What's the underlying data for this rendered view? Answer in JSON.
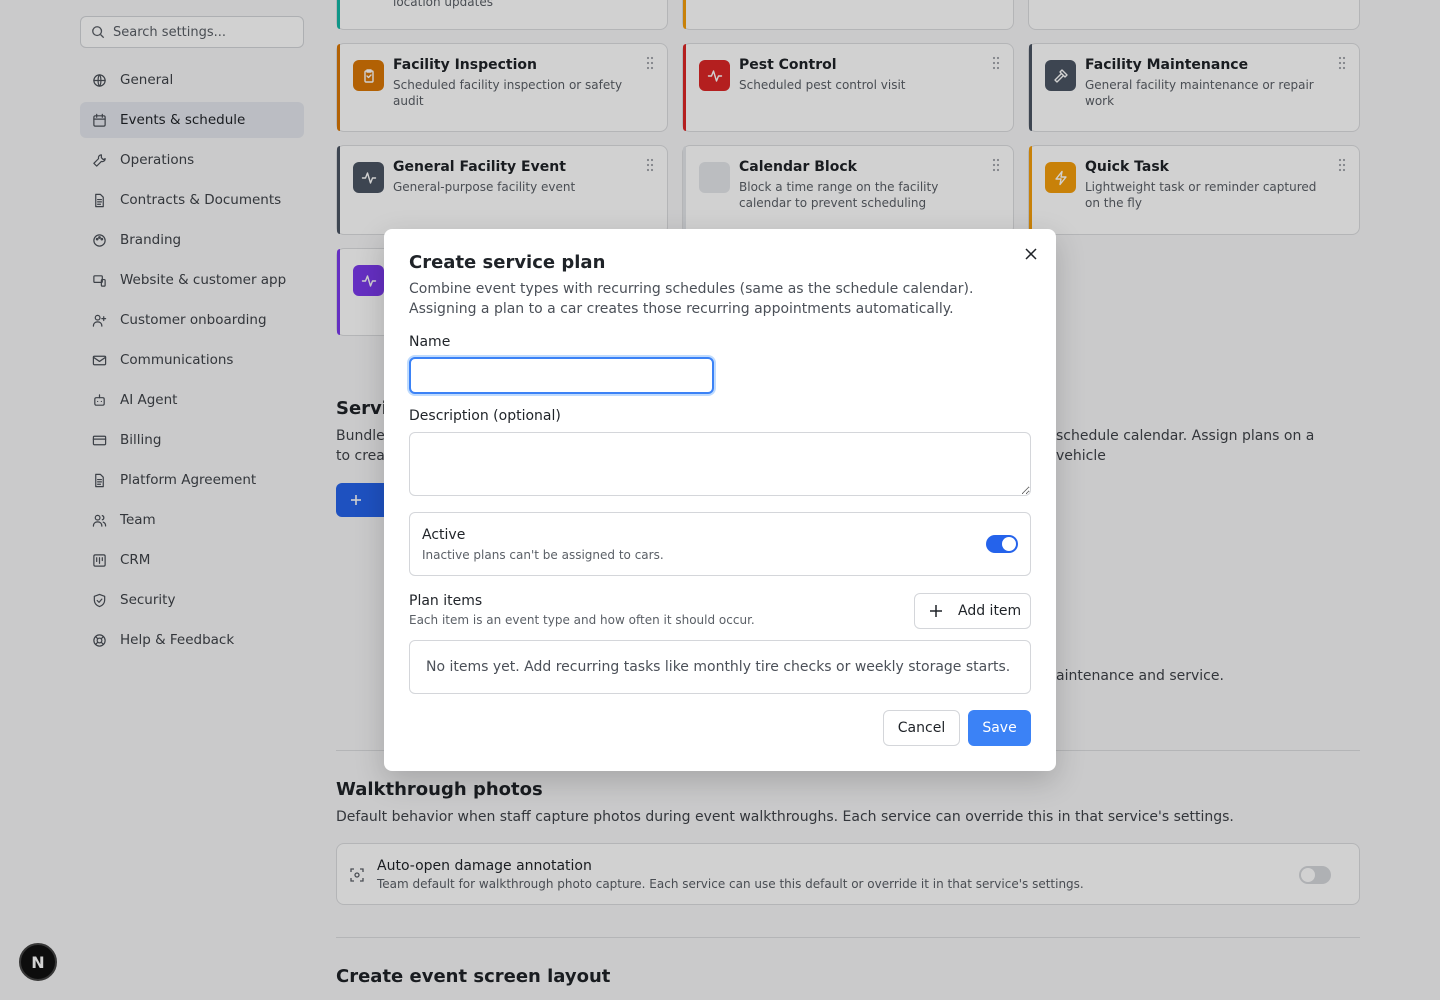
{
  "sidebar": {
    "search_placeholder": "Search settings...",
    "items": [
      {
        "label": "General",
        "icon": "globe-icon",
        "active": false
      },
      {
        "label": "Events & schedule",
        "icon": "calendar-icon",
        "active": true
      },
      {
        "label": "Operations",
        "icon": "wrench-icon",
        "active": false
      },
      {
        "label": "Contracts & Documents",
        "icon": "document-icon",
        "active": false
      },
      {
        "label": "Branding",
        "icon": "palette-icon",
        "active": false
      },
      {
        "label": "Website & customer app",
        "icon": "devices-icon",
        "active": false
      },
      {
        "label": "Customer onboarding",
        "icon": "user-plus-icon",
        "active": false
      },
      {
        "label": "Communications",
        "icon": "mail-icon",
        "active": false
      },
      {
        "label": "AI Agent",
        "icon": "bot-icon",
        "active": false
      },
      {
        "label": "Billing",
        "icon": "credit-card-icon",
        "active": false
      },
      {
        "label": "Platform Agreement",
        "icon": "document-icon",
        "active": false
      },
      {
        "label": "Team",
        "icon": "users-icon",
        "active": false
      },
      {
        "label": "CRM",
        "icon": "crm-icon",
        "active": false
      },
      {
        "label": "Security",
        "icon": "shield-icon",
        "active": false
      },
      {
        "label": "Help & Feedback",
        "icon": "lifebuoy-icon",
        "active": false
      }
    ]
  },
  "event_cards": {
    "top_partial_text": "location updates",
    "cards": [
      {
        "title": "Facility Inspection",
        "desc": "Scheduled facility inspection or safety audit",
        "color": "#d97706",
        "icon": "clipboard-icon"
      },
      {
        "title": "Pest Control",
        "desc": "Scheduled pest control visit",
        "color": "#dc2626",
        "icon": "activity-icon"
      },
      {
        "title": "Facility Maintenance",
        "desc": "General facility maintenance or repair work",
        "color": "#4b5563",
        "icon": "hammer-icon"
      },
      {
        "title": "General Facility Event",
        "desc": "General-purpose facility event",
        "color": "#4b5563",
        "icon": "activity-icon"
      },
      {
        "title": "Calendar Block",
        "desc": "Block a time range on the facility calendar to prevent scheduling",
        "color": "#e5e7eb",
        "icon": "block-icon"
      },
      {
        "title": "Quick Task",
        "desc": "Lightweight task or reminder captured on the fly",
        "color": "#f59e0b",
        "icon": "zap-icon"
      },
      {
        "title": "",
        "desc": "",
        "color": "#7c3aed",
        "icon": "activity-icon"
      }
    ]
  },
  "service_plans": {
    "title_partial": "Servi",
    "desc_line1_partial": "Bundle",
    "desc_line2_partial": "to creat",
    "desc_right": "schedule calendar. Assign plans on a vehicle",
    "maint_right": "aintenance and service."
  },
  "walkthrough": {
    "title": "Walkthrough photos",
    "desc": "Default behavior when staff capture photos during event walkthroughs. Each service can override this in that service's settings.",
    "setting_title": "Auto-open damage annotation",
    "setting_desc": "Team default for walkthrough photo capture. Each service can use this default or override it in that service's settings.",
    "enabled": false
  },
  "layout_section": {
    "title": "Create event screen layout"
  },
  "modal": {
    "title": "Create service plan",
    "desc": "Combine event types with recurring schedules (same as the schedule calendar). Assigning a plan to a car creates those recurring appointments automatically.",
    "name_label": "Name",
    "name_value": "",
    "description_label": "Description (optional)",
    "description_value": "",
    "active_title": "Active",
    "active_desc": "Inactive plans can't be assigned to cars.",
    "active_on": true,
    "plan_items_title": "Plan items",
    "plan_items_desc": "Each item is an event type and how often it should occur.",
    "add_item_label": "Add item",
    "empty_text": "No items yet. Add recurring tasks like monthly tire checks or weekly storage starts.",
    "cancel_label": "Cancel",
    "save_label": "Save"
  },
  "badge": {
    "letter": "N"
  }
}
